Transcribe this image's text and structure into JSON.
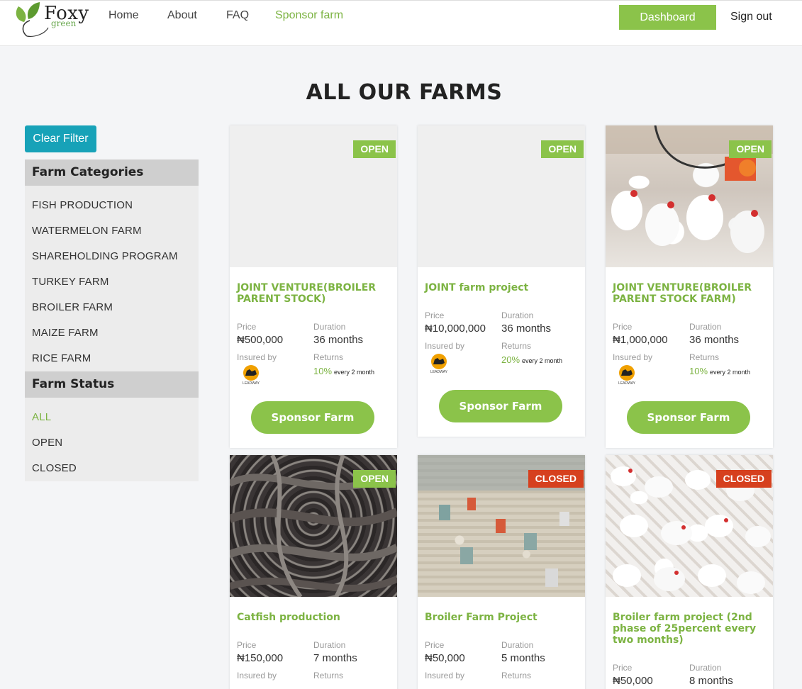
{
  "header": {
    "logo_main": "Foxy",
    "logo_sub": "green",
    "nav": [
      {
        "label": "Home"
      },
      {
        "label": "About"
      },
      {
        "label": "FAQ"
      },
      {
        "label": "Sponsor farm"
      }
    ],
    "dashboard_label": "Dashboard",
    "signout_label": "Sign out"
  },
  "page_title": "ALL OUR FARMS",
  "sidebar": {
    "clear_filter_label": "Clear Filter",
    "categories_heading": "Farm Categories",
    "categories": [
      "FISH PRODUCTION",
      "WATERMELON FARM",
      "SHAREHOLDING PROGRAM",
      "TURKEY FARM",
      "BROILER FARM",
      "MAIZE FARM",
      "RICE FARM"
    ],
    "status_heading": "Farm Status",
    "statuses": [
      "ALL",
      "OPEN",
      "CLOSED"
    ],
    "active_status": "ALL"
  },
  "labels": {
    "price": "Price",
    "duration": "Duration",
    "insured_by": "Insured by",
    "returns": "Returns",
    "sponsor_button": "Sponsor Farm",
    "insurer": "LEADWAY"
  },
  "farms": [
    {
      "status": "OPEN",
      "title": "JOINT VENTURE(BROILER PARENT STOCK)",
      "price": "₦500,000",
      "duration": "36 months",
      "returns": "10%",
      "returns_note": "every 2 month",
      "image": "placeholder"
    },
    {
      "status": "OPEN",
      "title": "JOINT farm project",
      "price": "₦10,000,000",
      "duration": "36 months",
      "returns": "20%",
      "returns_note": "every 2 month",
      "image": "placeholder"
    },
    {
      "status": "OPEN",
      "title": "JOINT VENTURE(BROILER PARENT STOCK FARM)",
      "price": "₦1,000,000",
      "duration": "36 months",
      "returns": "10%",
      "returns_note": "every 2 month",
      "image": "hens-photo"
    },
    {
      "status": "OPEN",
      "title": "Catfish production",
      "price": "₦150,000",
      "duration": "7 months",
      "image": "catfish-photo"
    },
    {
      "status": "CLOSED",
      "title": "Broiler Farm Project",
      "price": "₦50,000",
      "duration": "5 months",
      "image": "chicks-photo"
    },
    {
      "status": "CLOSED",
      "title": "Broiler farm project (2nd phase of 25percent every two months)",
      "price": "₦50,000",
      "duration": "8 months",
      "image": "broilers-photo"
    }
  ],
  "colors": {
    "accent": "#8bc34a",
    "accent_text": "#7cb342",
    "closed": "#d6401e",
    "clear_filter": "#17a2b8"
  }
}
